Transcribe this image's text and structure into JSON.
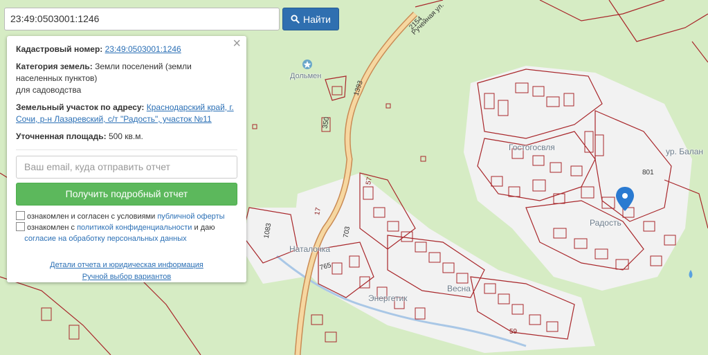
{
  "search": {
    "value": "23:49:0503001:1246",
    "button_label": "Найти"
  },
  "panel": {
    "cadastral_label": "Кадастровый номер:",
    "cadastral_value": "23:49:0503001:1246",
    "category_label": "Категория земель:",
    "category_value": "Земли поселений (земли населенных пунктов)",
    "category_purpose": "для садоводства",
    "address_label": "Земельный участок по адресу:",
    "address_value": "Краснодарский край, г. Сочи, р-н Лазаревский, с/т \"Радость\", участок №11",
    "area_label": "Уточненная площадь:",
    "area_value": "500 кв.м.",
    "email_placeholder": "Ваш email, куда отправить отчет",
    "report_button": "Получить подробный отчет",
    "consent1_text": "ознакомлен и согласен с условиями",
    "consent1_link": "публичной оферты",
    "consent2_text": "ознакомлен с",
    "consent2_link1": "политикой конфиденциальности",
    "consent2_mid": "и даю",
    "consent2_link2": "согласие на обработку персональных данных",
    "link_details": "Детали отчета и юридическая информация",
    "link_manual": "Ручной выбор вариантов"
  },
  "map": {
    "labels": {
      "dolmen": "Дольмен",
      "gostogoslya": "Гостогосвля",
      "radost": "Радость",
      "energetik": "Энергетик",
      "vesna": "Весна",
      "natalochka": "Наталочка",
      "balanka": "ур. Балан",
      "street": "Ручейная ул."
    },
    "road_numbers": [
      "1393",
      "2154",
      "350",
      "1083",
      "703",
      "765",
      "801",
      "57",
      "17",
      "59"
    ],
    "colors": {
      "parcel": "#a8262a",
      "road_fill": "#f6d7a0",
      "forest": "#d6ecc4",
      "settlement": "#f2f2f2",
      "marker": "#2a7ad1"
    }
  }
}
